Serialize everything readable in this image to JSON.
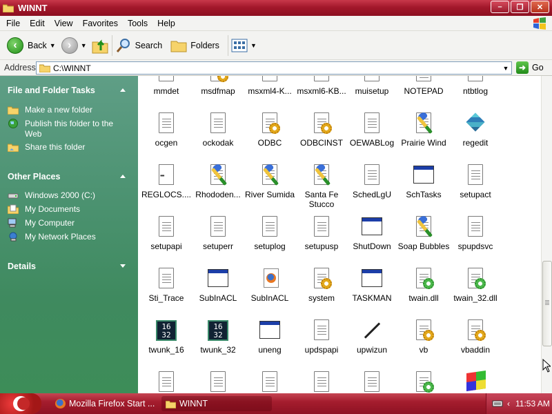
{
  "window": {
    "title": "WINNT"
  },
  "menu": [
    "File",
    "Edit",
    "View",
    "Favorites",
    "Tools",
    "Help"
  ],
  "toolbar": {
    "back": "Back",
    "search": "Search",
    "folders": "Folders"
  },
  "address": {
    "label": "Address",
    "path": "C:\\WINNT",
    "go": "Go"
  },
  "sidebar": {
    "tasks_title": "File and Folder Tasks",
    "tasks": [
      "Make a new folder",
      "Publish this folder to the Web",
      "Share this folder"
    ],
    "places_title": "Other Places",
    "places": [
      "Windows 2000 (C:)",
      "My Documents",
      "My Computer",
      "My Network Places"
    ],
    "details_title": "Details"
  },
  "files": [
    {
      "name": "mmdet",
      "icon": "text-doc-icon"
    },
    {
      "name": "msdfmap",
      "icon": "config-doc-icon"
    },
    {
      "name": "msxml4-K...",
      "icon": "text-doc-icon"
    },
    {
      "name": "msxml6-KB...",
      "icon": "text-doc-icon"
    },
    {
      "name": "muisetup",
      "icon": "text-doc-icon"
    },
    {
      "name": "NOTEPAD",
      "icon": "notepad-icon"
    },
    {
      "name": "ntbtlog",
      "icon": "text-doc-icon"
    },
    {
      "name": "ocgen",
      "icon": "text-doc-icon"
    },
    {
      "name": "ockodak",
      "icon": "text-doc-icon"
    },
    {
      "name": "ODBC",
      "icon": "config-doc-icon"
    },
    {
      "name": "ODBCINST",
      "icon": "config-doc-icon"
    },
    {
      "name": "OEWABLog",
      "icon": "text-doc-icon"
    },
    {
      "name": "Prairie Wind",
      "icon": "paintbrush-icon"
    },
    {
      "name": "regedit",
      "icon": "regedit-icon"
    },
    {
      "name": "REGLOCS....",
      "icon": "registry-doc-icon"
    },
    {
      "name": "Rhododen...",
      "icon": "paintbrush-icon"
    },
    {
      "name": "River Sumida",
      "icon": "paintbrush-icon"
    },
    {
      "name": "Santa Fe Stucco",
      "icon": "paintbrush-icon"
    },
    {
      "name": "SchedLgU",
      "icon": "text-doc-icon"
    },
    {
      "name": "SchTasks",
      "icon": "app-window-icon"
    },
    {
      "name": "setupact",
      "icon": "text-doc-icon"
    },
    {
      "name": "setupapi",
      "icon": "text-doc-icon"
    },
    {
      "name": "setuperr",
      "icon": "text-doc-icon"
    },
    {
      "name": "setuplog",
      "icon": "text-doc-icon"
    },
    {
      "name": "setupusp",
      "icon": "text-doc-icon"
    },
    {
      "name": "ShutDown",
      "icon": "app-window-icon"
    },
    {
      "name": "Soap Bubbles",
      "icon": "paintbrush-icon"
    },
    {
      "name": "spupdsvc",
      "icon": "text-doc-icon"
    },
    {
      "name": "Sti_Trace",
      "icon": "text-doc-icon"
    },
    {
      "name": "SubInACL",
      "icon": "app-window-icon"
    },
    {
      "name": "SubInACL",
      "icon": "firefox-doc-icon"
    },
    {
      "name": "system",
      "icon": "config-doc-icon"
    },
    {
      "name": "TASKMAN",
      "icon": "app-window-icon"
    },
    {
      "name": "twain.dll",
      "icon": "dll-icon"
    },
    {
      "name": "twain_32.dll",
      "icon": "dll-icon"
    },
    {
      "name": "twunk_16",
      "icon": "twunk-icon"
    },
    {
      "name": "twunk_32",
      "icon": "twunk-icon"
    },
    {
      "name": "uneng",
      "icon": "app-window-icon"
    },
    {
      "name": "updspapi",
      "icon": "text-doc-icon"
    },
    {
      "name": "upwizun",
      "icon": "wand-icon"
    },
    {
      "name": "vb",
      "icon": "config-doc-icon"
    },
    {
      "name": "vbaddin",
      "icon": "config-doc-icon"
    },
    {
      "name": "",
      "icon": "text-doc-icon"
    },
    {
      "name": "",
      "icon": "text-doc-icon"
    },
    {
      "name": "",
      "icon": "text-doc-icon"
    },
    {
      "name": "",
      "icon": "text-doc-icon"
    },
    {
      "name": "",
      "icon": "text-doc-icon"
    },
    {
      "name": "",
      "icon": "dll-icon"
    },
    {
      "name": "",
      "icon": "windows-flag-icon"
    }
  ],
  "twunk_labels": {
    "top": "16",
    "bottom": "32",
    "top2": "16",
    "bottom2": "32"
  },
  "taskbar": {
    "tasks": [
      "Mozilla Firefox Start ...",
      "WINNT"
    ],
    "time": "11:53 AM"
  },
  "colors": {
    "titlebar": "#a3182b",
    "sidebar": "#4b9270",
    "taskbar": "#a51d2e"
  }
}
